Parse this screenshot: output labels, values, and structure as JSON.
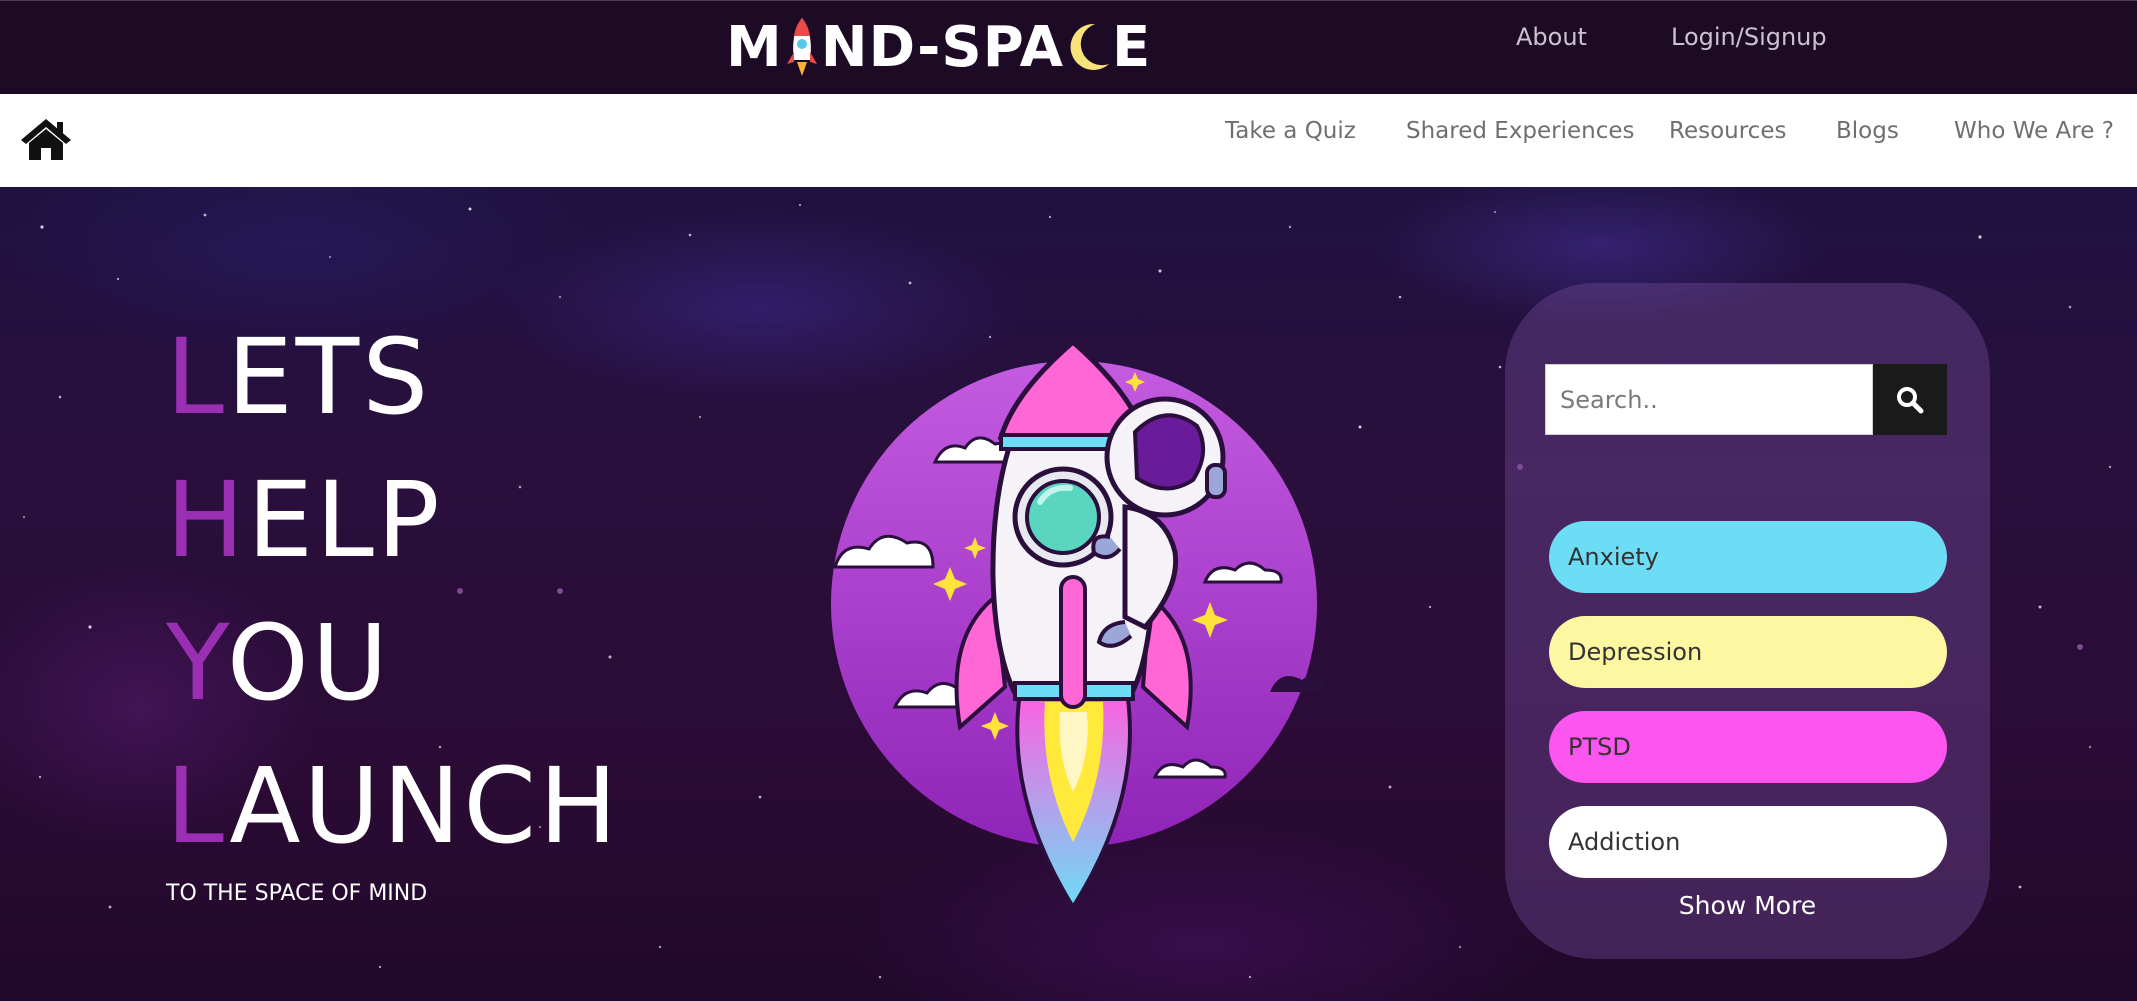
{
  "header": {
    "logo_text": "MIND-SPACE",
    "logo_parts": [
      "M",
      "ND-SPA",
      "E"
    ],
    "links": [
      {
        "label": "About"
      },
      {
        "label": "Login/Signup"
      }
    ]
  },
  "nav": {
    "home_icon": "home-icon",
    "items": [
      {
        "label": "Take a Quiz"
      },
      {
        "label": "Shared Experiences"
      },
      {
        "label": "Resources"
      },
      {
        "label": "Blogs"
      },
      {
        "label": "Who We Are ?"
      }
    ]
  },
  "hero": {
    "headline": [
      {
        "first": "L",
        "rest": "ETS"
      },
      {
        "first": "H",
        "rest": "ELP"
      },
      {
        "first": "Y",
        "rest": "OU"
      },
      {
        "first": "L",
        "rest": "AUNCH"
      }
    ],
    "tagline": "TO THE SPACE OF MIND",
    "accent_color": "#9b2fb4"
  },
  "panel": {
    "search": {
      "placeholder": "Search..",
      "value": "",
      "icon": "search-icon"
    },
    "topics": [
      {
        "label": "Anxiety",
        "color": "#6ddcf5"
      },
      {
        "label": "Depression",
        "color": "#fcf7a0"
      },
      {
        "label": "PTSD",
        "color": "#fc55f0"
      },
      {
        "label": "Addiction",
        "color": "#ffffff"
      }
    ],
    "show_more": "Show More"
  }
}
